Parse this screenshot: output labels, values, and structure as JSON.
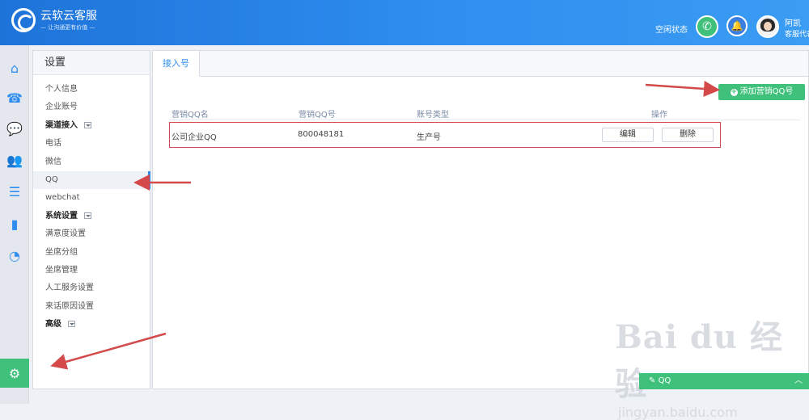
{
  "app": {
    "title": "云软云客服",
    "slogan": "— 让沟通更有价值 —"
  },
  "header": {
    "status_label": "空闲状态",
    "user_name": "阿凯",
    "user_role": "客服代表"
  },
  "sidebar": {
    "title": "设置",
    "items": [
      {
        "label": "个人信息",
        "group": false
      },
      {
        "label": "企业账号",
        "group": false
      },
      {
        "label": "渠道接入",
        "group": true
      },
      {
        "label": "电话",
        "group": false
      },
      {
        "label": "微信",
        "group": false
      },
      {
        "label": "QQ",
        "group": false
      },
      {
        "label": "webchat",
        "group": false
      },
      {
        "label": "系统设置",
        "group": true
      },
      {
        "label": "满意度设置",
        "group": false
      },
      {
        "label": "坐席分组",
        "group": false
      },
      {
        "label": "坐席管理",
        "group": false
      },
      {
        "label": "人工服务设置",
        "group": false
      },
      {
        "label": "来话原因设置",
        "group": false
      },
      {
        "label": "高级",
        "group": true
      }
    ],
    "selected": "QQ"
  },
  "main": {
    "tab_label": "接入号",
    "add_button_label": "添加营销QQ号",
    "columns": [
      "营销QQ名",
      "营销QQ号",
      "账号类型",
      "操作"
    ],
    "rows": [
      {
        "name": "公司企业QQ",
        "number": "800048181",
        "type": "生产号",
        "edit_label": "编辑",
        "delete_label": "删除"
      }
    ]
  },
  "footer": {
    "qq_tab_label": "QQ"
  },
  "watermark": {
    "brand": "Bai du 经验",
    "url": "jingyan.baidu.com"
  },
  "colors": {
    "accent_blue": "#2f8ef0",
    "accent_green": "#3fc17c",
    "highlight_red": "#d44a4a"
  }
}
